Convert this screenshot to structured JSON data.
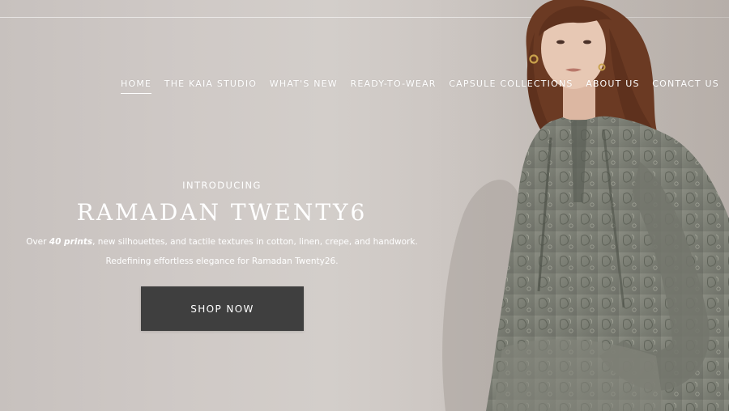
{
  "nav": {
    "items": [
      {
        "label": "HOME",
        "active": true
      },
      {
        "label": "THE KAIA STUDIO",
        "active": false
      },
      {
        "label": "WHAT'S NEW",
        "active": false
      },
      {
        "label": "READY-TO-WEAR",
        "active": false
      },
      {
        "label": "CAPSULE COLLECTIONS",
        "active": false
      },
      {
        "label": "ABOUT US",
        "active": false
      },
      {
        "label": "CONTACT US",
        "active": false
      }
    ]
  },
  "hero": {
    "eyebrow": "INTRODUCING",
    "title": "RAMADAN TWENTY6",
    "description": {
      "part1": "Over ",
      "emphasis": "40 prints",
      "part2": ", new silhouettes, and tactile textures in cotton, linen, crepe, and handwork."
    },
    "subtitle": "Redefining effortless elegance for Ramadan Twenty26.",
    "cta_label": "SHOP NOW"
  },
  "colors": {
    "background": "#cdc7c3",
    "button": "#3f3f3f",
    "text": "#ffffff",
    "dress": "#7d8076"
  }
}
